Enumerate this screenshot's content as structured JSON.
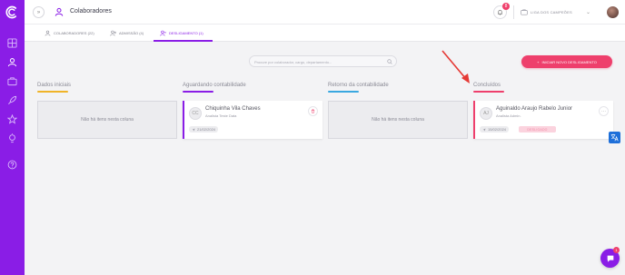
{
  "colors": {
    "brand": "#8a1de6",
    "accent": "#ee3f6c",
    "background": "#f3f3f5",
    "col_dados": "#f0b429",
    "col_aguardando": "#8a1de6",
    "col_retorno": "#3aa8e0",
    "col_concluidos": "#ee3f6c"
  },
  "sidebar": {
    "icons": [
      "logo-icon",
      "dashboard-icon",
      "user-icon",
      "briefcase-icon",
      "rocket-icon",
      "star-icon",
      "lightbulb-icon",
      "help-icon"
    ]
  },
  "header": {
    "collapse_symbol": "»",
    "title": "Colaboradores",
    "notifications_count": "8",
    "company": "LIGA DOS CAMPEÕES",
    "chevron": "⌄"
  },
  "tabs": [
    {
      "label": "COLABORADORES (22)",
      "active": false
    },
    {
      "label": "ADMISSÃO (4)",
      "active": false
    },
    {
      "label": "DESLIGAMENTO (1)",
      "active": true
    }
  ],
  "search": {
    "placeholder": "Procure por colaborador, cargo, departamento..."
  },
  "actions": {
    "start_dismissal": "INICIAR NOVO DESLIGAMENTO",
    "plus": "+"
  },
  "columns": [
    {
      "title": "Dados iniciais",
      "empty_text": "Não há itens nesta coluna"
    },
    {
      "title": "Aguardando contabilidade"
    },
    {
      "title": "Retorno da contabilidade",
      "empty_text": "Não há itens nesta coluna"
    },
    {
      "title": "Concluídos"
    }
  ],
  "cards": {
    "aguardando": {
      "initials": "CC",
      "name": "Chiquinha Vila Chaves",
      "role": "Analista Teste Data",
      "date": "21/02/2024"
    },
    "concluidos": {
      "initials": "AJ",
      "name": "Aguinaldo Araujo Rabelo Junior",
      "role": "Analista Admin.",
      "date": "15/02/2024",
      "status": "DESLIGADO",
      "more": "···"
    }
  },
  "chat": {
    "badge": "1"
  }
}
